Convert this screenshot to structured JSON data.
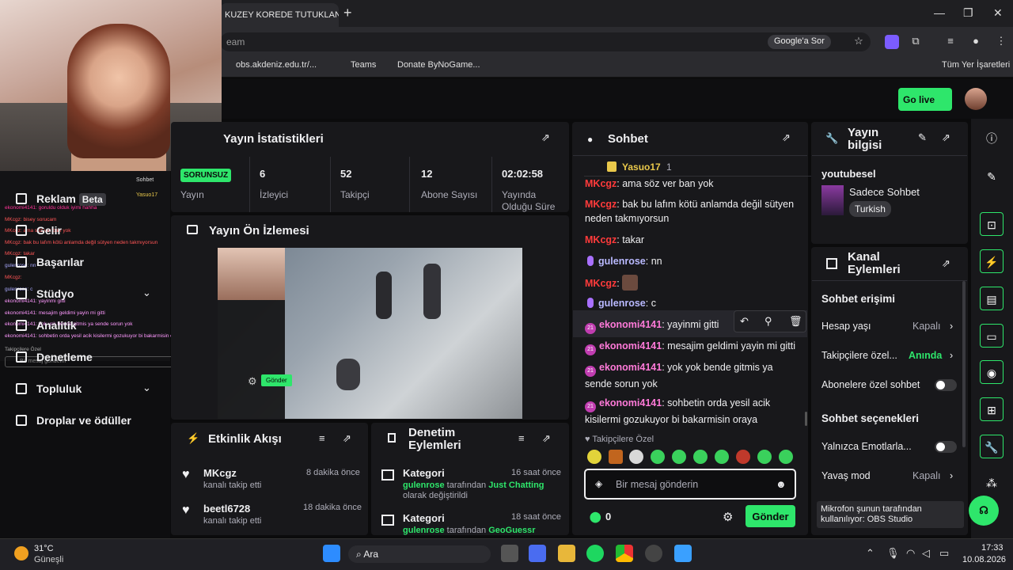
{
  "browser": {
    "tab_title": "KUZEY KOREDE TUTUKLAN",
    "new_tab": "+",
    "address": "eam",
    "google_ask": "Google'a Sor",
    "bookmarks": [
      "obs.akdeniz.edu.tr/...",
      "Teams",
      "Donate ByNoGame..."
    ],
    "all_bookmarks": "Tüm Yer İşaretleri"
  },
  "appbar": {
    "go_live": "Go live"
  },
  "nav": {
    "items": [
      "Reklam",
      "Gelir",
      "Başarılar",
      "Stüdyo",
      "Analitik",
      "Denetleme",
      "Topluluk",
      "Droplar ve ödüller"
    ],
    "beta": "Beta"
  },
  "overlay_chat": {
    "title": "Sohbet",
    "top_user": "Yasuo17",
    "top_count": "1",
    "lines": [
      "ekonomi4141: goruldu olduk iyimi hahha",
      "MKcgz: bisey sorucam",
      "MKcgz: ama söz ver ban yok",
      "MKcgz: bak bu lafım kötü anlamda değil sütyen neden takmıyorsun",
      "MKcgz: takar",
      "gulenrose: nn",
      "MKcgz:",
      "gulenrose: c",
      "ekonomi4141: yayinmi gitti",
      "ekonomi4141: mesajim geldimi yayin mi gitti",
      "ekonomi4141: yok yok bende gitmis ya sende sorun yok",
      "ekonomi4141: sohbetin orda yesil acik kisilermi gozukuyor bi bakarmisin oraya"
    ],
    "followers_only": "Takipçilere Özel",
    "input_placeholder": "Bir mesaj gönderin"
  },
  "stats": {
    "title": "Yayın İstatistikleri",
    "items": [
      {
        "value": "SORUNSUZ",
        "label": "Yayın"
      },
      {
        "value": "6",
        "label": "İzleyici"
      },
      {
        "value": "52",
        "label": "Takipçi"
      },
      {
        "value": "12",
        "label": "Abone Sayısı"
      },
      {
        "value": "02:02:58",
        "label": "Yayında Olduğu Süre"
      }
    ]
  },
  "preview": {
    "title": "Yayın Ön İzlemesi",
    "send": "Gönder"
  },
  "activity": {
    "title": "Etkinlik Akışı",
    "items": [
      {
        "user": "MKcgz",
        "text": "kanalı takip etti",
        "time": "8 dakika önce"
      },
      {
        "user": "beetl6728",
        "text": "kanalı takip etti",
        "time": "18 dakika önce"
      }
    ]
  },
  "moderation": {
    "title": "Denetim Eylemleri",
    "items": [
      {
        "title": "Kategori",
        "time": "16 saat önce",
        "actor": "gulenrose",
        "mid": "tarafından",
        "target": "Just Chatting",
        "rest": "olarak değiştirildi"
      },
      {
        "title": "Kategori",
        "time": "18 saat önce",
        "actor": "gulenrose",
        "mid": "tarafından",
        "target": "GeoGuessr",
        "rest": "olarak"
      }
    ]
  },
  "chat": {
    "title": "Sohbet",
    "pinned_user": "Yasuo17",
    "pinned_count": "1",
    "messages": [
      {
        "user": "MKcgz",
        "text": ": ama söz ver ban yok"
      },
      {
        "user": "MKcgz",
        "text": ": bak bu lafım kötü anlamda değil sütyen neden takmıyorsun"
      },
      {
        "user": "MKcgz",
        "text": ": takar"
      },
      {
        "user": "gulenrose",
        "text": ": nn"
      },
      {
        "user": "MKcgz",
        "text": ":"
      },
      {
        "user": "gulenrose",
        "text": ": c"
      },
      {
        "user": "ekonomi4141",
        "text": ": yayinmi gitti"
      },
      {
        "user": "ekonomi4141",
        "text": ": mesajim geldimi yayin mi gitti"
      },
      {
        "user": "ekonomi4141",
        "text": ": yok yok bende gitmis ya sende sorun yok"
      },
      {
        "user": "ekonomi4141",
        "text": ": sohbetin orda yesil acik kisilermi gozukuyor bi bakarmisin oraya"
      }
    ],
    "badge": "21",
    "followers_only": "Takipçilere Özel",
    "input_placeholder": "Bir mesaj gönderin",
    "points": "0",
    "send": "Gönder"
  },
  "stream_info": {
    "title": "Yayın bilgisi",
    "channel": "youtubesel",
    "category": "Sadece Sohbet",
    "tag": "Turkish"
  },
  "channel_actions": {
    "title": "Kanal Eylemleri",
    "section1": "Sohbet erişimi",
    "rows1": [
      {
        "label": "Hesap yaşı",
        "value": "Kapalı"
      },
      {
        "label": "Takipçilere özel...",
        "value": "Anında"
      },
      {
        "label": "Abonelere özel sohbet",
        "value": ""
      }
    ],
    "section2": "Sohbet seçenekleri",
    "rows2": [
      {
        "label": "Yalnızca Emotlarla...",
        "value": ""
      },
      {
        "label": "Yavaş mod",
        "value": "Kapalı"
      }
    ],
    "mic_tooltip": "Mikrofon şunun tarafından kullanılıyor: OBS Studio"
  },
  "taskbar": {
    "temp": "31°C",
    "weather": "Güneşli",
    "search": "Ara",
    "time": "17:33",
    "date": "10.08.2026"
  },
  "colors": {
    "accent": "#2ee66b",
    "danger": "#ff3b3b",
    "purple": "#a970ff"
  }
}
